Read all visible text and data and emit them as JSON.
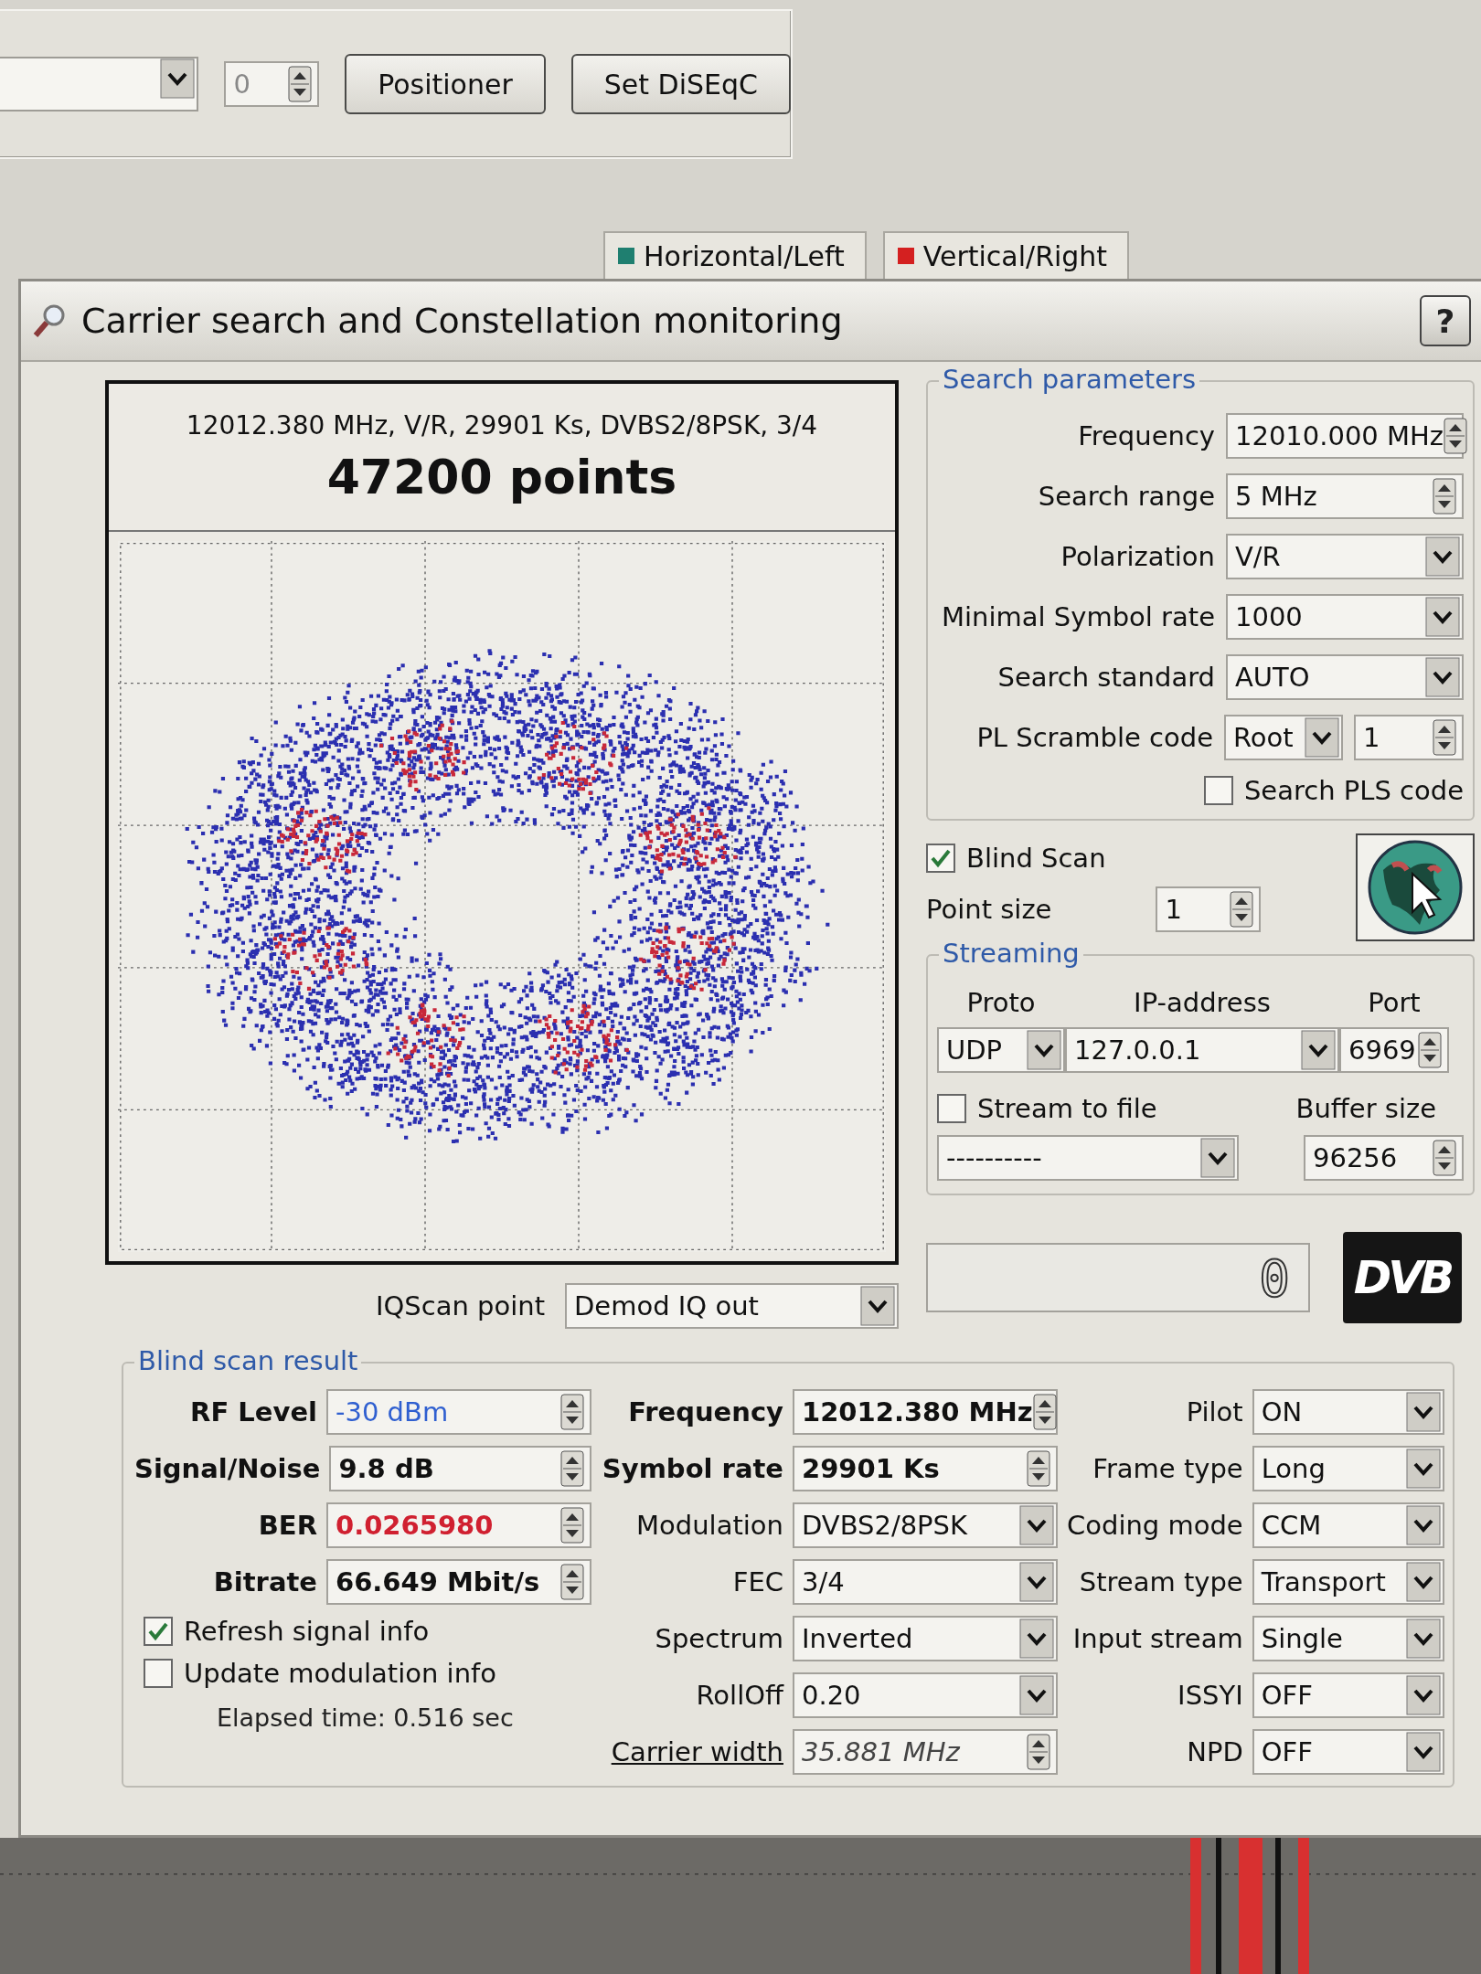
{
  "toolbar": {
    "spin_value": "0",
    "buttons": [
      "Positioner",
      "Set DiSEqC"
    ]
  },
  "polarization_tabs": [
    {
      "label": "Horizontal/Left",
      "color": "#1f7f70"
    },
    {
      "label": "Vertical/Right",
      "color": "#d42020"
    }
  ],
  "dialog": {
    "title": "Carrier search and Constellation monitoring",
    "help_button": "?"
  },
  "constellation": {
    "info": "12012.380 MHz, V/R, 29901 Ks, DVBS2/8PSK, 3/4",
    "points": "47200 points"
  },
  "search_parameters": {
    "title": "Search parameters",
    "fields": [
      {
        "label": "Frequency",
        "value": "12010.000 MHz",
        "kind": "spin"
      },
      {
        "label": "Search range",
        "value": "5 MHz",
        "kind": "spin"
      },
      {
        "label": "Polarization",
        "value": "V/R",
        "kind": "combo"
      },
      {
        "label": "Minimal Symbol rate",
        "value": "1000",
        "kind": "combo"
      },
      {
        "label": "Search standard",
        "value": "AUTO",
        "kind": "combo"
      },
      {
        "label": "PL Scramble code",
        "value": "Root",
        "value2": "1",
        "kind": "combospin"
      }
    ],
    "search_pls": {
      "label": "Search PLS code",
      "checked": false
    }
  },
  "blind_scan": {
    "label": "Blind Scan",
    "checked": true
  },
  "point_size": {
    "label": "Point size",
    "value": "1"
  },
  "streaming": {
    "title": "Streaming",
    "columns": [
      "Proto",
      "IP-address",
      "Port"
    ],
    "proto": "UDP",
    "ip": "127.0.0.1",
    "port": "6969",
    "stream_to_file": {
      "label": "Stream to file",
      "checked": false
    },
    "buffer_label": "Buffer size",
    "file": "----------",
    "buffer": "96256"
  },
  "iq_scan": {
    "label": "IQScan point",
    "value": "Demod IQ out"
  },
  "lcd_value": "0",
  "logo_text": "DVB",
  "blind_scan_result": {
    "title": "Blind scan result",
    "columns": [
      [
        {
          "label": "RF Level",
          "value": "-30 dBm",
          "kind": "spin",
          "bold": true,
          "value_bold": false,
          "color": "#2f5fd0"
        },
        {
          "label": "Signal/Noise",
          "value": "9.8 dB",
          "kind": "spin",
          "bold": true,
          "value_bold": true,
          "color": "#111111"
        },
        {
          "label": "BER",
          "value": "0.0265980",
          "kind": "spin",
          "bold": true,
          "value_bold": true,
          "color": "#d02030"
        },
        {
          "label": "Bitrate",
          "value": "66.649 Mbit/s",
          "kind": "spin",
          "bold": true,
          "value_bold": true,
          "color": "#111111"
        }
      ],
      [
        {
          "label": "Frequency",
          "value": "12012.380 MHz",
          "kind": "spin",
          "bold": true,
          "value_bold": true,
          "color": "#111111"
        },
        {
          "label": "Symbol rate",
          "value": "29901 Ks",
          "kind": "spin",
          "bold": true,
          "value_bold": true,
          "color": "#111111"
        },
        {
          "label": "Modulation",
          "value": "DVBS2/8PSK",
          "kind": "combo",
          "bold": false,
          "value_bold": false,
          "color": "#111111"
        },
        {
          "label": "FEC",
          "value": "3/4",
          "kind": "combo",
          "bold": false,
          "value_bold": false,
          "color": "#111111"
        },
        {
          "label": "Spectrum",
          "value": "Inverted",
          "kind": "combo",
          "bold": false,
          "value_bold": false,
          "color": "#111111"
        },
        {
          "label": "RollOff",
          "value": "0.20",
          "kind": "combo",
          "bold": false,
          "value_bold": false,
          "color": "#111111"
        },
        {
          "label": "Carrier width",
          "value": "35.881 MHz",
          "kind": "spin",
          "bold": false,
          "value_bold": false,
          "link": true,
          "color": "#444444",
          "italic": true
        }
      ],
      [
        {
          "label": "Pilot",
          "value": "ON",
          "kind": "combo",
          "bold": false,
          "value_bold": false,
          "color": "#111111"
        },
        {
          "label": "Frame type",
          "value": "Long",
          "kind": "combo",
          "bold": false,
          "value_bold": false,
          "color": "#111111"
        },
        {
          "label": "Coding mode",
          "value": "CCM",
          "kind": "combo",
          "bold": false,
          "value_bold": false,
          "color": "#111111"
        },
        {
          "label": "Stream type",
          "value": "Transport",
          "kind": "combo",
          "bold": false,
          "value_bold": false,
          "color": "#111111"
        },
        {
          "label": "Input stream",
          "value": "Single",
          "kind": "combo",
          "bold": false,
          "value_bold": false,
          "color": "#111111"
        },
        {
          "label": "ISSYI",
          "value": "OFF",
          "kind": "combo",
          "bold": false,
          "value_bold": false,
          "color": "#111111"
        },
        {
          "label": "NPD",
          "value": "OFF",
          "kind": "combo",
          "bold": false,
          "value_bold": false,
          "color": "#111111"
        }
      ]
    ],
    "checkboxes": [
      {
        "label": "Refresh signal info",
        "checked": true
      },
      {
        "label": "Update modulation info",
        "checked": false
      }
    ],
    "elapsed": "Elapsed time: 0.516 sec"
  }
}
